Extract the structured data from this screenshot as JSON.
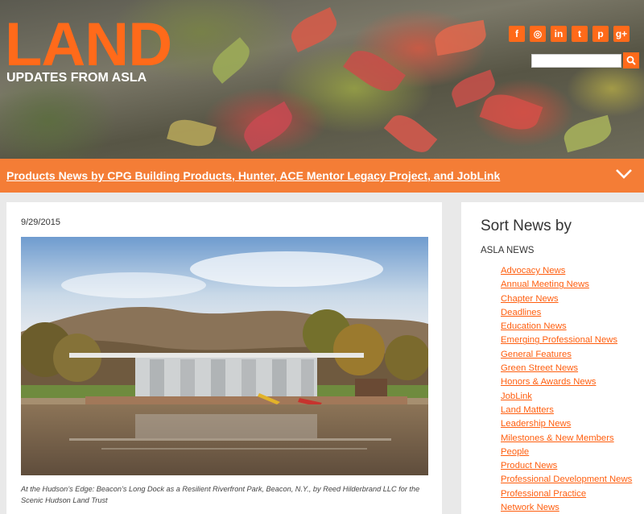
{
  "header": {
    "logo_title": "LAND",
    "logo_subtitle": "UPDATES FROM ASLA",
    "social_icons": [
      "facebook-icon",
      "instagram-icon",
      "linkedin-icon",
      "twitter-icon",
      "pinterest-icon",
      "google-plus-icon"
    ],
    "social_glyphs": [
      "f",
      "◎",
      "in",
      "t",
      "p",
      "g+"
    ],
    "search_placeholder": "",
    "accent_color": "#ff6a1a"
  },
  "topic_bar": {
    "link_text": "Products News by CPG Building Products, Hunter, ACE Mentor Legacy Project, and JobLink",
    "bar_color": "#f47d36"
  },
  "article": {
    "date": "9/29/2015",
    "caption": "At the Hudson’s Edge: Beacon’s Long Dock as a Resilient Riverfront Park, Beacon, N.Y., by Reed Hilderbrand LLC for the Scenic Hudson Land Trust"
  },
  "sidebar": {
    "title": "Sort News by",
    "section_label": "ASLA NEWS",
    "items": [
      "Advocacy News",
      "Annual Meeting News",
      "Chapter News",
      "Deadlines",
      "Education News",
      "Emerging Professional News",
      "General Features",
      "Green Street News",
      "Honors & Awards News",
      "JobLink",
      "Land Matters",
      "Leadership News",
      "Milestones & New Members",
      "People",
      "Product News",
      "Professional Development News",
      "Professional Practice",
      "Network News"
    ],
    "link_color": "#ff5e0e"
  }
}
